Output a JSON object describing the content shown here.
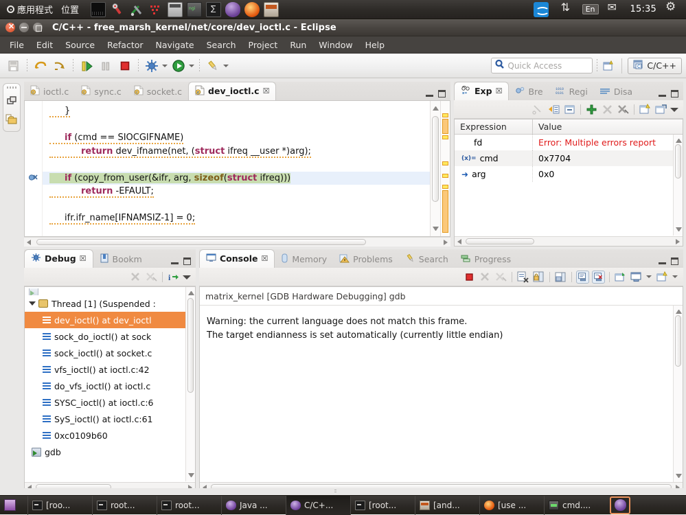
{
  "gnome_panel": {
    "applications_label": "應用程式",
    "places_label": "位置",
    "launchers": [
      {
        "name": "terminal-launcher-icon",
        "cls": "ic-term"
      },
      {
        "name": "wrench-launcher-icon",
        "cls": "ic-wrench"
      },
      {
        "name": "tools-launcher-icon",
        "cls": "ic-tools"
      },
      {
        "name": "red-tools-launcher-icon",
        "cls": "ic-redtools"
      },
      {
        "name": "calculator-launcher-icon",
        "cls": "ic-calc"
      },
      {
        "name": "nginx-launcher-icon",
        "cls": "ic-nginx"
      },
      {
        "name": "shell-launcher-icon",
        "cls": "ic-shell"
      },
      {
        "name": "eclipse-launcher-icon",
        "cls": "ic-eclipse"
      },
      {
        "name": "firefox-launcher-icon",
        "cls": "ic-firefox"
      },
      {
        "name": "archive-launcher-icon",
        "cls": "ic-archive"
      }
    ],
    "tray": {
      "teamviewer_icon": "teamviewer-icon",
      "network_icon": "network-updown-icon",
      "language": "En",
      "mail_icon": "mail-icon",
      "clock": "15:35",
      "settings_icon": "gear-icon"
    }
  },
  "window": {
    "title": "C/C++ - free_marsh_kernel/net/core/dev_ioctl.c - Eclipse",
    "buttons": {
      "close": "close-button",
      "minimize": "minimize-button",
      "maximize": "maximize-button"
    }
  },
  "menubar": {
    "items": [
      "File",
      "Edit",
      "Source",
      "Refactor",
      "Navigate",
      "Search",
      "Project",
      "Run",
      "Window",
      "Help"
    ]
  },
  "toolbar": {
    "icons": [
      "save-icon",
      "skip-breakpoints-icon",
      "step-return-icon",
      "resume-icon",
      "suspend-icon",
      "terminate-icon",
      "debug-icon",
      "run-icon",
      "external-tools-icon"
    ],
    "quick_access_placeholder": "Quick Access",
    "search_icon": "search-icon",
    "new_perspective_icon": "new-perspective-icon",
    "perspective_label": "C/C++",
    "perspective_icon": "cpp-perspective-icon"
  },
  "fast_view": {
    "items": [
      "restore-icon",
      "project-explorer-icon"
    ]
  },
  "editor": {
    "tabs": [
      {
        "label": "ioctl.c",
        "active": false
      },
      {
        "label": "sync.c",
        "active": false
      },
      {
        "label": "socket.c",
        "active": false
      },
      {
        "label": "dev_ioctl.c",
        "active": true
      }
    ],
    "close_glyph": "☒",
    "controls": {
      "minimize": "minimize-part-button",
      "maximize": "maximize-part-button"
    },
    "code_lines": [
      {
        "indent": 1,
        "segments": [
          {
            "t": "}",
            "c": "squig"
          }
        ]
      },
      {
        "indent": 0,
        "segments": []
      },
      {
        "indent": 1,
        "segments": [
          {
            "t": "if",
            "c": "kw"
          },
          {
            "t": " (cmd == SIOCGIFNAME)",
            "c": "squig"
          }
        ]
      },
      {
        "indent": 2,
        "segments": [
          {
            "t": "return",
            "c": "kw"
          },
          {
            "t": " dev_ifname(net, ",
            "c": "squig"
          },
          {
            "t": "struct",
            "c": "kw"
          },
          {
            "t": " ifreq __user *)arg);",
            "c": "squig"
          }
        ]
      },
      {
        "indent": 0,
        "segments": []
      },
      {
        "indent": 1,
        "exec": true,
        "hl": true,
        "segments": [
          {
            "t": "if",
            "c": "kw"
          },
          {
            "t": " (copy_from_user(&ifr, arg, ",
            "c": ""
          },
          {
            "t": "sizeof",
            "c": "kw2"
          },
          {
            "t": "(",
            "c": ""
          },
          {
            "t": "struct",
            "c": "kw"
          },
          {
            "t": " ifreq)))",
            "c": ""
          }
        ]
      },
      {
        "indent": 2,
        "segments": [
          {
            "t": "return",
            "c": "kw"
          },
          {
            "t": " -EFAULT;",
            "c": "squig"
          }
        ]
      },
      {
        "indent": 0,
        "segments": []
      },
      {
        "indent": 1,
        "segments": [
          {
            "t": "ifr.ifr_name[IFNAMSIZ-1] = 0;",
            "c": "squig"
          }
        ]
      }
    ],
    "breakpoint_icon": "breakpoint-skip-icon"
  },
  "expressions_view": {
    "tabs": [
      {
        "label": "Exp",
        "icon": "expressions-icon",
        "active": true
      },
      {
        "label": "Bre",
        "icon": "breakpoints-icon",
        "active": false
      },
      {
        "label": "Regi",
        "icon": "registers-icon",
        "active": false
      },
      {
        "label": "Disa",
        "icon": "disassembly-icon",
        "active": false
      }
    ],
    "close_glyph": "☒",
    "toolbar_icons": [
      "cut-expression-icon",
      "convert-icon",
      "collapse-all-icon",
      "add-expression-icon",
      "remove-expression-icon",
      "remove-all-expressions-icon",
      "new-watchlist-icon",
      "export-icon"
    ],
    "menu_icon": "view-menu-icon",
    "columns": [
      "Expression",
      "Value"
    ],
    "rows": [
      {
        "icon": "",
        "expression": "fd",
        "value": "Error: Multiple errors report",
        "value_error": true
      },
      {
        "icon": "(x)=",
        "expression": "cmd",
        "value": "0x7704",
        "value_error": false
      },
      {
        "icon": "➜",
        "expression": "arg",
        "value": "0x0",
        "value_error": false
      }
    ]
  },
  "debug_view": {
    "tabs": [
      {
        "label": "Debug",
        "icon": "debug-icon",
        "active": true
      },
      {
        "label": "Bookm",
        "icon": "bookmarks-icon",
        "active": false
      }
    ],
    "close_glyph": "☒",
    "toolbar_icons": [
      "disconnect-icon",
      "remove-all-terminated-icon",
      "step-info-icon"
    ],
    "menu_icon": "view-menu-icon",
    "tree": [
      {
        "type": "partial",
        "label": ""
      },
      {
        "type": "thread",
        "label": "Thread [1] (Suspended : ",
        "indent": 1,
        "twisty": true
      },
      {
        "type": "frame",
        "label": "dev_ioctl() at dev_ioctl",
        "indent": 2,
        "selected": true
      },
      {
        "type": "frame",
        "label": "sock_do_ioctl() at sock",
        "indent": 2,
        "selected": false
      },
      {
        "type": "frame",
        "label": "sock_ioctl() at socket.c",
        "indent": 2,
        "selected": false
      },
      {
        "type": "frame",
        "label": "vfs_ioctl() at ioctl.c:42",
        "indent": 2,
        "selected": false
      },
      {
        "type": "frame",
        "label": "do_vfs_ioctl() at ioctl.c",
        "indent": 2,
        "selected": false
      },
      {
        "type": "frame",
        "label": "SYSC_ioctl() at ioctl.c:6",
        "indent": 2,
        "selected": false
      },
      {
        "type": "frame",
        "label": "SyS_ioctl() at ioctl.c:61",
        "indent": 2,
        "selected": false
      },
      {
        "type": "frame",
        "label": "0xc0109b60",
        "indent": 2,
        "selected": false
      },
      {
        "type": "process",
        "label": "gdb",
        "indent": 1,
        "selected": false
      }
    ]
  },
  "console_view": {
    "tabs": [
      {
        "label": "Console",
        "icon": "console-icon",
        "active": true
      },
      {
        "label": "Memory",
        "icon": "memory-icon",
        "active": false
      },
      {
        "label": "Problems",
        "icon": "problems-icon",
        "active": false
      },
      {
        "label": "Search",
        "icon": "search-view-icon",
        "active": false
      },
      {
        "label": "Progress",
        "icon": "progress-icon",
        "active": false
      }
    ],
    "close_glyph": "☒",
    "toolbar_icons": [
      "terminate-console-icon",
      "remove-launch-icon",
      "remove-all-launches-icon",
      "clear-console-icon",
      "scroll-lock-icon",
      "word-wrap-icon",
      "show-console-on-output-icon",
      "show-console-on-error-icon",
      "pin-console-icon",
      "display-selected-console-icon",
      "open-console-icon"
    ],
    "header": "matrix_kernel [GDB Hardware Debugging] gdb",
    "lines": [
      "Warning: the current language does not match this frame.",
      "The target endianness is set automatically (currently little endian)"
    ]
  },
  "taskbar": {
    "show_desktop_icon": "show-desktop-icon",
    "tasks": [
      {
        "label": "[roo...",
        "icon": "term",
        "active": false
      },
      {
        "label": "root...",
        "icon": "term",
        "active": false
      },
      {
        "label": "root...",
        "icon": "term",
        "active": false
      },
      {
        "label": "Java ...",
        "icon": "ecl",
        "active": false
      },
      {
        "label": "C/C+...",
        "icon": "ecl",
        "active": true
      },
      {
        "label": "[root...",
        "icon": "term",
        "active": false
      },
      {
        "label": "[and...",
        "icon": "arch",
        "active": false
      },
      {
        "label": "[use ...",
        "icon": "ff",
        "active": false
      },
      {
        "label": "cmd....",
        "icon": "ngx",
        "active": false
      }
    ],
    "last_icon": "eclipse-window-icon"
  },
  "colors": {
    "panel_bg": "#2e2b28",
    "selection_orange": "#f08a41",
    "error_red": "#e01b1b",
    "keyword_magenta": "#9e2a5c",
    "exec_line_blue": "#e8f0fb",
    "highlight_green": "#c8ddb0",
    "ruler_yellow": "#ffe95e"
  }
}
